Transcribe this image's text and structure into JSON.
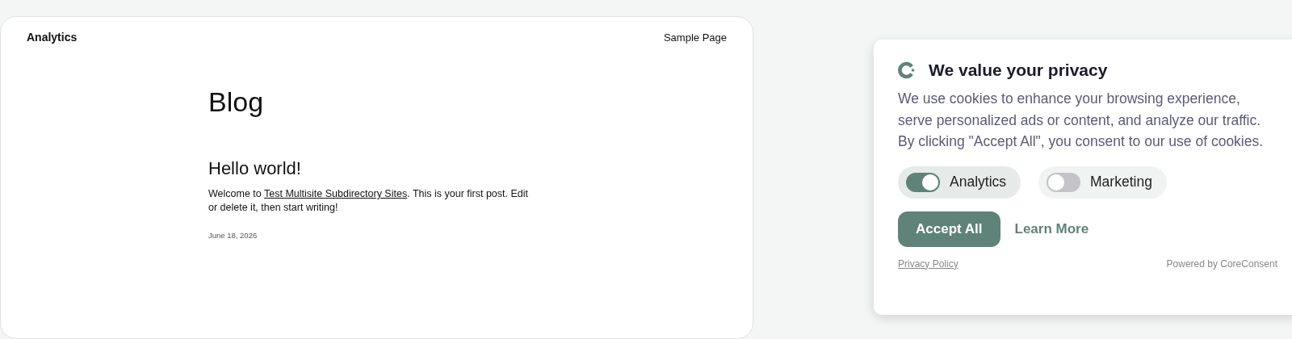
{
  "site": {
    "title": "Analytics",
    "nav": [
      {
        "label": "Sample Page"
      }
    ]
  },
  "blog": {
    "heading": "Blog",
    "posts": [
      {
        "title": "Hello world!",
        "text_before": "Welcome to ",
        "link": "Test Multisite Subdirectory Sites",
        "text_after": ". This is your first post. Edit or delete it, then start writing!",
        "date": "June 18, 2026"
      }
    ]
  },
  "consent": {
    "title": "We value your privacy",
    "body": "We use cookies to enhance your browsing experience, serve personalized ads or content, and analyze our traffic. By clicking \"Accept All\", you consent to our use of cookies.",
    "toggles": [
      {
        "label": "Analytics",
        "on": true
      },
      {
        "label": "Marketing",
        "on": false
      }
    ],
    "accept": "Accept All",
    "learn_more": "Learn More",
    "privacy_link": "Privacy Policy",
    "powered_by": "Powered by CoreConsent"
  }
}
